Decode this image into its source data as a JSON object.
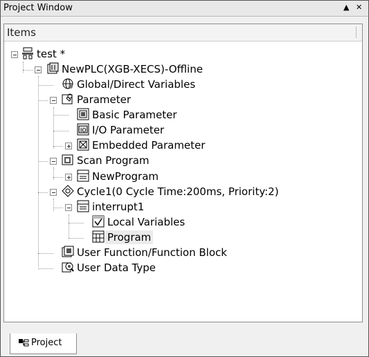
{
  "window": {
    "title": "Project Window",
    "controls": [
      "▲",
      "✕"
    ]
  },
  "tree_header": "Items",
  "tree": [
    {
      "label": "test *",
      "icon": "project-icon",
      "expander": "minus"
    },
    {
      "label": "NewPLC(XGB-XECS)-Offline",
      "icon": "plc-icon",
      "expander": "minus"
    },
    {
      "label": "Global/Direct Variables",
      "icon": "globe-variables-icon",
      "expander": "none"
    },
    {
      "label": "Parameter",
      "icon": "parameter-folder-icon",
      "expander": "minus"
    },
    {
      "label": "Basic Parameter",
      "icon": "basic-parameter-icon",
      "expander": "none"
    },
    {
      "label": "I/O Parameter",
      "icon": "io-parameter-icon",
      "expander": "none"
    },
    {
      "label": "Embedded Parameter",
      "icon": "embedded-parameter-icon",
      "expander": "plus"
    },
    {
      "label": "Scan Program",
      "icon": "scan-program-icon",
      "expander": "minus"
    },
    {
      "label": "NewProgram",
      "icon": "program-icon",
      "expander": "plus"
    },
    {
      "label": "Cycle1(0 Cycle Time:200ms, Priority:2)",
      "icon": "cycle-task-icon",
      "expander": "minus"
    },
    {
      "label": "interrupt1",
      "icon": "program-icon",
      "expander": "minus"
    },
    {
      "label": "Local Variables",
      "icon": "local-variables-icon",
      "expander": "none"
    },
    {
      "label": "Program",
      "icon": "program-body-icon",
      "expander": "none",
      "selected": true
    },
    {
      "label": "User Function/Function Block",
      "icon": "function-block-icon",
      "expander": "none"
    },
    {
      "label": "User Data Type",
      "icon": "data-type-icon",
      "expander": "none"
    }
  ],
  "tabs": [
    {
      "label": "Project",
      "icon": "project-tab-icon",
      "active": true
    }
  ]
}
